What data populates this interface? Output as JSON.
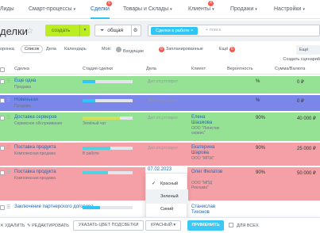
{
  "nav": {
    "items": [
      {
        "label": "Лиды",
        "chev": false
      },
      {
        "label": "Смарт-процессы",
        "chev": true
      },
      {
        "label": "Сделки",
        "chev": false,
        "badge": "6"
      },
      {
        "label": "Товары и Склады",
        "chev": true
      },
      {
        "label": "Клиенты",
        "chev": true,
        "badge": "4"
      },
      {
        "label": "Продажи",
        "chev": true
      },
      {
        "label": "Настройки",
        "chev": true
      }
    ]
  },
  "toolbar": {
    "title": "делки",
    "create_label": "создать",
    "category": "общая",
    "search_chip": "Сделки в работе",
    "search_placeholder": "+ поиск"
  },
  "views": {
    "items": [
      "оронка",
      "Список",
      "Дела",
      "Календарь"
    ],
    "active_index": 1,
    "moe": "Моё:",
    "incoming": "Входящие",
    "planned_badge": "6",
    "planned": "Запланированные",
    "more": "Ещё",
    "more_badge": "6",
    "more_label": "Ещё"
  },
  "settings_link": "Создать сценарий",
  "table": {
    "headers": [
      "Сделка",
      "Стадия сделки",
      "Дела",
      "Клиент",
      "Вероятность",
      "Сумма/Валюта"
    ],
    "rows": [
      {
        "title": "Еще одна",
        "subtitle": "Продажа",
        "stage_label": "",
        "stage_fill": 0.25,
        "stage_color": "#2fc6f6",
        "deals": "Дел отсутствуют",
        "client": "",
        "client_company": "",
        "probability": "%",
        "sum": "0 ₽",
        "bg": "#96e294"
      },
      {
        "title": "Новенькая",
        "subtitle": "Продажа",
        "stage_label": "",
        "stage_fill": 0.25,
        "stage_color": "#2fc6f6",
        "deals": "Дел отсутствуют",
        "client": "",
        "client_company": "",
        "probability": "%",
        "sum": "0 ₽",
        "bg": "#7b87e8"
      },
      {
        "title": "Доставка серверов",
        "subtitle": "Сервисное обслуживание",
        "stage_label": "Зелёный чат",
        "stage_fill": 0.75,
        "stage_color": "#d5e05c",
        "deals": "Дел отсутствуют",
        "client": "Елена Шашкова",
        "client_company": "ООО \"Логистик сервис\"",
        "probability": "90%",
        "sum": "40 000 ₽",
        "bg": "#96e294"
      },
      {
        "title": "Поставка продукта",
        "subtitle": "Комплексная продажа",
        "stage_label": "В работе",
        "stage_fill": 0.55,
        "stage_color": "#55d0e0",
        "deals": "Дел отсутствуют",
        "client": "Екатерина Шарова",
        "client_company": "ООО \"МПЖ\"",
        "probability": "90%",
        "sum": "25 000 ₽",
        "bg": "#f4a0a6"
      },
      {
        "title": "Поставка продукта",
        "subtitle": "Комплексная продажа",
        "stage_label": "",
        "stage_fill": 0.5,
        "stage_color": "#55d0e0",
        "deals": "07.02.2023",
        "client": "Олег Филатов",
        "client_company": "ООО \"МПД Реклама\"",
        "probability": "90%",
        "sum": "50 000 ₽",
        "bg": "#f4a0a6"
      },
      {
        "title": "Заключение партнерского договора",
        "subtitle": "",
        "stage_label": "",
        "stage_fill": 0.35,
        "stage_color": "#2fc6f6",
        "deals": "",
        "client": "Станислав Тихонов",
        "client_company": "",
        "probability": "",
        "sum": "",
        "bg": "#ffffff"
      }
    ]
  },
  "dropdown": {
    "items": [
      {
        "label": "Красный",
        "checked": true
      },
      {
        "label": "Зеленый",
        "checked": false
      },
      {
        "label": "Синий",
        "checked": false
      }
    ]
  },
  "bottom": {
    "delete": "УДАЛИТЬ",
    "edit": "РЕДАКТИРОВАТЬ",
    "color_btn": "УКАЗАТЬ ЦВЕТ ПОДСВЕТКИ",
    "color_value": "КРАСНЫЙ",
    "apply": "ПРИМЕНИТЬ",
    "for_all": "ДЛЯ ВСЕХ"
  }
}
